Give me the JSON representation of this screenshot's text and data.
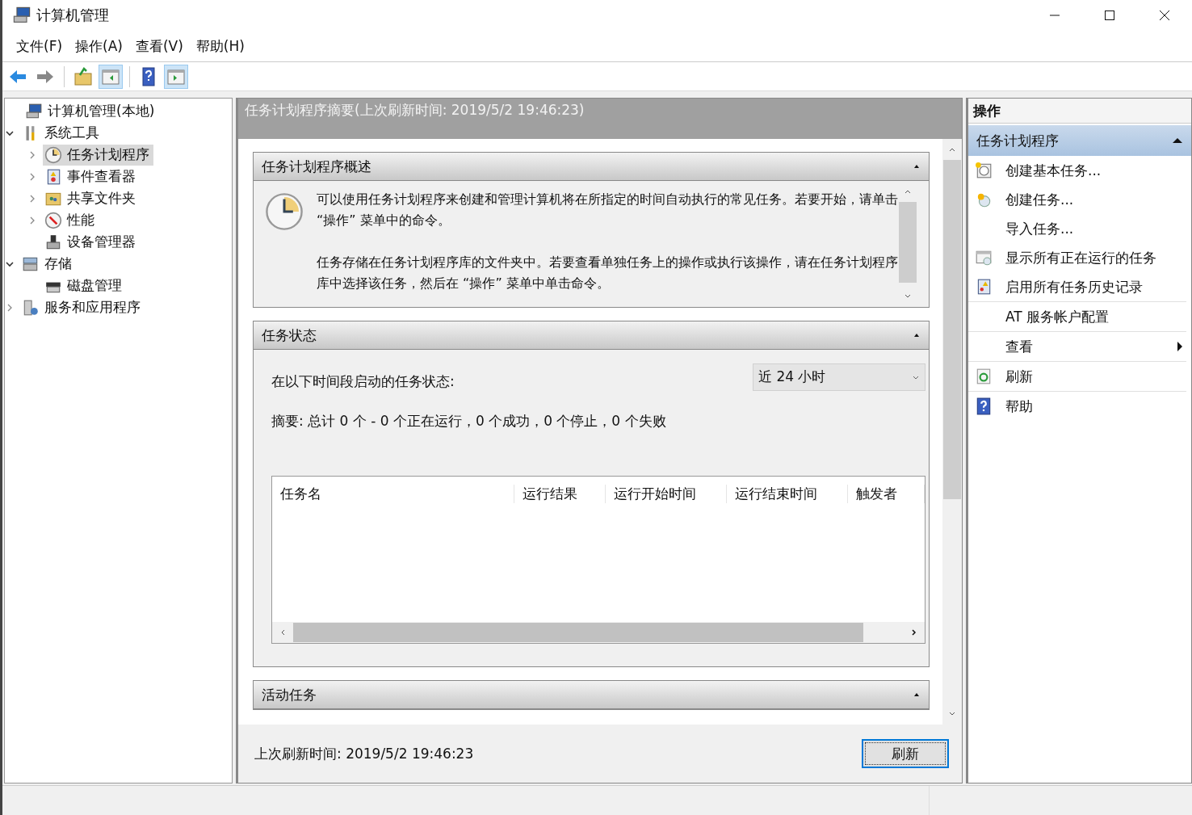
{
  "window": {
    "title": "计算机管理"
  },
  "menu": [
    "文件(F)",
    "操作(A)",
    "查看(V)",
    "帮助(H)"
  ],
  "toolbar": [
    {
      "pressed": false,
      "disabled": false
    },
    {
      "pressed": false,
      "disabled": true
    },
    {
      "pressed": false
    },
    {
      "pressed": true
    },
    {
      "pressed": false
    },
    {
      "pressed": true
    }
  ],
  "tree": [
    {
      "label": "计算机管理(本地)",
      "selected": false,
      "children": [
        {
          "label": "系统工具",
          "selected": false,
          "expanded": true,
          "children": [
            {
              "label": "任务计划程序",
              "selected": true,
              "expanded": false
            },
            {
              "label": "事件查看器",
              "selected": false,
              "expanded": false
            },
            {
              "label": "共享文件夹",
              "selected": false,
              "expanded": false
            },
            {
              "label": "性能",
              "selected": false,
              "expanded": false
            },
            {
              "label": "设备管理器",
              "selected": false
            }
          ]
        },
        {
          "label": "存储",
          "selected": false,
          "expanded": true,
          "children": [
            {
              "label": "磁盘管理",
              "selected": false
            }
          ]
        },
        {
          "label": "服务和应用程序",
          "selected": false,
          "expanded": false
        }
      ]
    }
  ],
  "center": {
    "title": "任务计划程序摘要(上次刷新时间: 2019/5/2 19:46:23)",
    "overview": {
      "title": "任务计划程序概述",
      "expanded": true,
      "paragraphs": [
        "可以使用任务计划程序来创建和管理计算机将在所指定的时间自动执行的常见任务。若要开始，请单击 “操作” 菜单中的命令。",
        "任务存储在任务计划程序库的文件夹中。若要查看单独任务上的操作或执行该操作，请在任务计划程序库中选择该任务，然后在 “操作” 菜单中单击命令。"
      ]
    },
    "status": {
      "title": "任务状态",
      "expanded": true,
      "period_label": "在以下时间段启动的任务状态:",
      "period": "近 24 小时",
      "summary": "摘要: 总计 0 个 - 0 个正在运行，0 个成功，0 个停止，0 个失败",
      "columns": [
        "任务名",
        "运行结果",
        "运行开始时间",
        "运行结束时间",
        "触发者"
      ]
    },
    "active": {
      "title": "活动任务",
      "expanded": true
    },
    "footer": {
      "last_refresh": "上次刷新时间: 2019/5/2 19:46:23",
      "button": "刷新"
    }
  },
  "actions": {
    "title": "操作",
    "sections": [
      {
        "title": "任务计划程序",
        "expanded": true,
        "groups": [
          [
            {
              "label": "创建基本任务...",
              "submenu": false
            },
            {
              "label": "创建任务...",
              "submenu": false
            },
            {
              "label": "导入任务...",
              "submenu": false
            },
            {
              "label": "显示所有正在运行的任务",
              "submenu": false
            },
            {
              "label": "启用所有任务历史记录",
              "submenu": false
            }
          ],
          [
            {
              "label": "AT 服务帐户配置",
              "submenu": false
            }
          ],
          [
            {
              "label": "查看",
              "submenu": true
            }
          ],
          [
            {
              "label": "刷新",
              "submenu": false
            }
          ],
          [
            {
              "label": "帮助",
              "submenu": false
            }
          ]
        ]
      }
    ]
  }
}
